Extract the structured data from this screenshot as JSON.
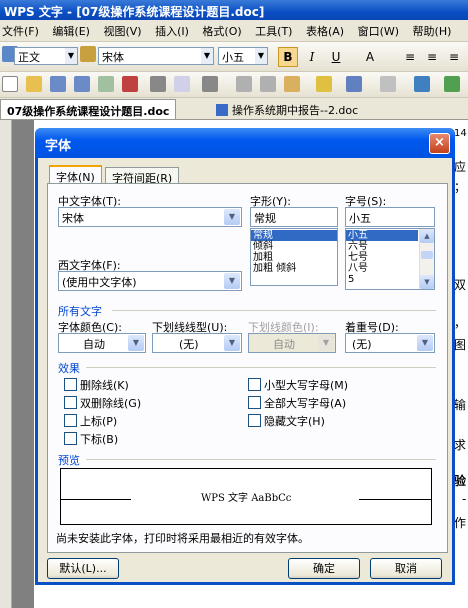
{
  "window": {
    "title": "WPS 文字 - [07级操作系统课程设计题目.doc]"
  },
  "menu": [
    "文件(F)",
    "编辑(E)",
    "视图(V)",
    "插入(I)",
    "格式(O)",
    "工具(T)",
    "表格(A)",
    "窗口(W)",
    "帮助(H)"
  ],
  "toolbar": {
    "style": "正文",
    "font": "宋体",
    "size": "小五",
    "bold": "B",
    "italic": "I",
    "underline": "U"
  },
  "doc_tabs": [
    "07级操作系统课程设计题目.doc",
    "操作系统期中报告--2.doc"
  ],
  "page_fragments": [
    "14",
    "应",
    "；",
    "双",
    "，",
    "图",
    "输",
    "求",
    "验",
    "-",
    "作"
  ],
  "dialog": {
    "title": "字体",
    "close": "×",
    "tabs": [
      "字体(N)",
      "字符间距(R)"
    ],
    "cn_font_label": "中文字体(T):",
    "cn_font_value": "宋体",
    "style_label": "字形(Y):",
    "style_value": "常规",
    "style_options": [
      "常规",
      "倾斜",
      "加粗",
      "加粗 倾斜"
    ],
    "size_label": "字号(S):",
    "size_value": "小五",
    "size_options": [
      "小五",
      "六号",
      "七号",
      "八号",
      "5"
    ],
    "west_font_label": "西文字体(F):",
    "west_font_value": "(使用中文字体)",
    "all_text_group": "所有文字",
    "color_label": "字体颜色(C):",
    "color_value": "自动",
    "underline_label": "下划线线型(U):",
    "underline_value": "(无)",
    "underline_color_label": "下划线颜色(I):",
    "underline_color_value": "自动",
    "emphasis_label": "着重号(D):",
    "emphasis_value": "(无)",
    "effects_group": "效果",
    "effects_left": [
      "删除线(K)",
      "双删除线(G)",
      "上标(P)",
      "下标(B)"
    ],
    "effects_right": [
      "小型大写字母(M)",
      "全部大写字母(A)",
      "隐藏文字(H)"
    ],
    "preview_group": "预览",
    "preview_text": "WPS 文字 AaBbCc",
    "note": "尚未安装此字体，打印时将采用最相近的有效字体。",
    "default_button": "默认(L)...",
    "ok_button": "确定",
    "cancel_button": "取消"
  }
}
